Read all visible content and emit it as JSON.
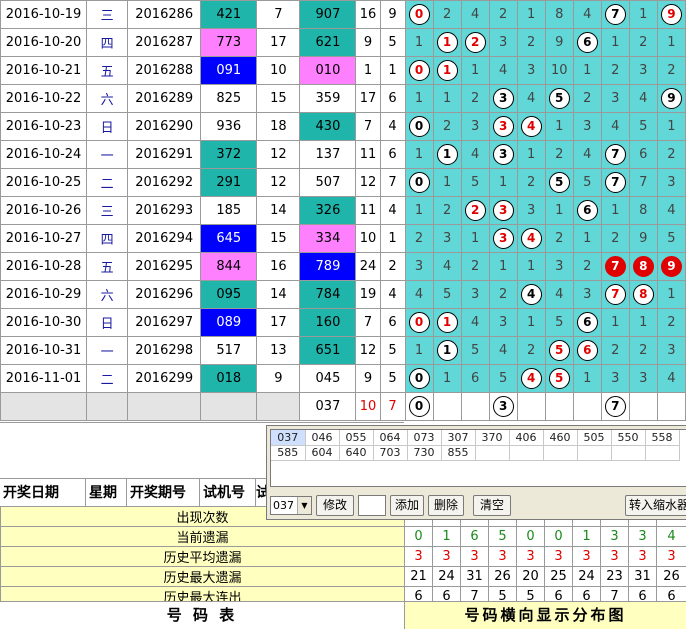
{
  "rows": [
    {
      "date": "2016-10-19",
      "week": "三",
      "period": "2016286",
      "trial": "421",
      "trial_bg": "tl",
      "sum": "7",
      "draw": "907",
      "draw_bg": "tl",
      "s2": "16",
      "s3": "9",
      "cells": [
        [
          "0",
          "r"
        ],
        [
          "2"
        ],
        [
          "4"
        ],
        [
          "2"
        ],
        [
          "1"
        ],
        [
          "8"
        ],
        [
          "4"
        ],
        [
          "7",
          "k"
        ],
        [
          "1"
        ],
        [
          "9",
          "r"
        ]
      ]
    },
    {
      "date": "2016-10-20",
      "week": "四",
      "period": "2016287",
      "trial": "773",
      "trial_bg": "pk",
      "sum": "17",
      "draw": "621",
      "draw_bg": "tl",
      "s2": "9",
      "s3": "5",
      "cells": [
        [
          "1"
        ],
        [
          "1",
          "r"
        ],
        [
          "2",
          "r"
        ],
        [
          "3"
        ],
        [
          "2"
        ],
        [
          "9"
        ],
        [
          "6",
          "k"
        ],
        [
          "1"
        ],
        [
          "2"
        ],
        [
          "1"
        ]
      ]
    },
    {
      "date": "2016-10-21",
      "week": "五",
      "period": "2016288",
      "trial": "091",
      "trial_bg": "bl",
      "sum": "10",
      "draw": "010",
      "draw_bg": "pk",
      "s2": "1",
      "s3": "1",
      "cells": [
        [
          "0",
          "r"
        ],
        [
          "1",
          "r"
        ],
        [
          "1"
        ],
        [
          "4"
        ],
        [
          "3"
        ],
        [
          "10"
        ],
        [
          "1"
        ],
        [
          "2"
        ],
        [
          "3"
        ],
        [
          "2"
        ]
      ]
    },
    {
      "date": "2016-10-22",
      "week": "六",
      "period": "2016289",
      "trial": "825",
      "trial_bg": "wh",
      "sum": "15",
      "draw": "359",
      "draw_bg": "wh",
      "s2": "17",
      "s3": "6",
      "cells": [
        [
          "1"
        ],
        [
          "1"
        ],
        [
          "2"
        ],
        [
          "3",
          "k"
        ],
        [
          "4"
        ],
        [
          "5",
          "k"
        ],
        [
          "2"
        ],
        [
          "3"
        ],
        [
          "4"
        ],
        [
          "9",
          "k"
        ]
      ]
    },
    {
      "date": "2016-10-23",
      "week": "日",
      "period": "2016290",
      "trial": "936",
      "trial_bg": "wh",
      "sum": "18",
      "draw": "430",
      "draw_bg": "tl",
      "s2": "7",
      "s3": "4",
      "cells": [
        [
          "0",
          "k"
        ],
        [
          "2"
        ],
        [
          "3"
        ],
        [
          "3",
          "r"
        ],
        [
          "4",
          "r"
        ],
        [
          "1"
        ],
        [
          "3"
        ],
        [
          "4"
        ],
        [
          "5"
        ],
        [
          "1"
        ]
      ]
    },
    {
      "date": "2016-10-24",
      "week": "一",
      "period": "2016291",
      "trial": "372",
      "trial_bg": "tl",
      "sum": "12",
      "draw": "137",
      "draw_bg": "wh",
      "s2": "11",
      "s3": "6",
      "cells": [
        [
          "1"
        ],
        [
          "1",
          "k"
        ],
        [
          "4"
        ],
        [
          "3",
          "k"
        ],
        [
          "1"
        ],
        [
          "2"
        ],
        [
          "4"
        ],
        [
          "7",
          "k"
        ],
        [
          "6"
        ],
        [
          "2"
        ]
      ]
    },
    {
      "date": "2016-10-25",
      "week": "二",
      "period": "2016292",
      "trial": "291",
      "trial_bg": "tl",
      "sum": "12",
      "draw": "507",
      "draw_bg": "wh",
      "s2": "12",
      "s3": "7",
      "cells": [
        [
          "0",
          "k"
        ],
        [
          "1"
        ],
        [
          "5"
        ],
        [
          "1"
        ],
        [
          "2"
        ],
        [
          "5",
          "k"
        ],
        [
          "5"
        ],
        [
          "7",
          "k"
        ],
        [
          "7"
        ],
        [
          "3"
        ]
      ]
    },
    {
      "date": "2016-10-26",
      "week": "三",
      "period": "2016293",
      "trial": "185",
      "trial_bg": "wh",
      "sum": "14",
      "draw": "326",
      "draw_bg": "tl",
      "s2": "11",
      "s3": "4",
      "cells": [
        [
          "1"
        ],
        [
          "2"
        ],
        [
          "2",
          "r"
        ],
        [
          "3",
          "r"
        ],
        [
          "3"
        ],
        [
          "1"
        ],
        [
          "6",
          "k"
        ],
        [
          "1"
        ],
        [
          "8"
        ],
        [
          "4"
        ]
      ]
    },
    {
      "date": "2016-10-27",
      "week": "四",
      "period": "2016294",
      "trial": "645",
      "trial_bg": "bl",
      "sum": "15",
      "draw": "334",
      "draw_bg": "pk",
      "s2": "10",
      "s3": "1",
      "cells": [
        [
          "2"
        ],
        [
          "3"
        ],
        [
          "1"
        ],
        [
          "3",
          "r"
        ],
        [
          "4",
          "r"
        ],
        [
          "2"
        ],
        [
          "1"
        ],
        [
          "2"
        ],
        [
          "9"
        ],
        [
          "5"
        ]
      ]
    },
    {
      "date": "2016-10-28",
      "week": "五",
      "period": "2016295",
      "trial": "844",
      "trial_bg": "pk",
      "sum": "16",
      "draw": "789",
      "draw_bg": "bl",
      "s2": "24",
      "s3": "2",
      "cells": [
        [
          "3"
        ],
        [
          "4"
        ],
        [
          "2"
        ],
        [
          "1"
        ],
        [
          "1"
        ],
        [
          "3"
        ],
        [
          "2"
        ],
        [
          "7",
          "f"
        ],
        [
          "8",
          "f"
        ],
        [
          "9",
          "f"
        ]
      ]
    },
    {
      "date": "2016-10-29",
      "week": "六",
      "period": "2016296",
      "trial": "095",
      "trial_bg": "tl",
      "sum": "14",
      "draw": "784",
      "draw_bg": "tl",
      "s2": "19",
      "s3": "4",
      "cells": [
        [
          "4"
        ],
        [
          "5"
        ],
        [
          "3"
        ],
        [
          "2"
        ],
        [
          "4",
          "k"
        ],
        [
          "4"
        ],
        [
          "3"
        ],
        [
          "7",
          "r"
        ],
        [
          "8",
          "r"
        ],
        [
          "1"
        ]
      ]
    },
    {
      "date": "2016-10-30",
      "week": "日",
      "period": "2016297",
      "trial": "089",
      "trial_bg": "bl",
      "sum": "17",
      "draw": "160",
      "draw_bg": "tl",
      "s2": "7",
      "s3": "6",
      "cells": [
        [
          "0",
          "r"
        ],
        [
          "1",
          "r"
        ],
        [
          "4"
        ],
        [
          "3"
        ],
        [
          "1"
        ],
        [
          "5"
        ],
        [
          "6",
          "k"
        ],
        [
          "1"
        ],
        [
          "1"
        ],
        [
          "2"
        ]
      ]
    },
    {
      "date": "2016-10-31",
      "week": "一",
      "period": "2016298",
      "trial": "517",
      "trial_bg": "wh",
      "sum": "13",
      "draw": "651",
      "draw_bg": "tl",
      "s2": "12",
      "s3": "5",
      "cells": [
        [
          "1"
        ],
        [
          "1",
          "k"
        ],
        [
          "5"
        ],
        [
          "4"
        ],
        [
          "2"
        ],
        [
          "5",
          "r"
        ],
        [
          "6",
          "r"
        ],
        [
          "2"
        ],
        [
          "2"
        ],
        [
          "3"
        ]
      ]
    },
    {
      "date": "2016-11-01",
      "week": "二",
      "period": "2016299",
      "trial": "018",
      "trial_bg": "tl",
      "sum": "9",
      "draw": "045",
      "draw_bg": "wh",
      "s2": "9",
      "s3": "5",
      "cells": [
        [
          "0",
          "k"
        ],
        [
          "1"
        ],
        [
          "6"
        ],
        [
          "5"
        ],
        [
          "4",
          "r"
        ],
        [
          "5",
          "r"
        ],
        [
          "1"
        ],
        [
          "3"
        ],
        [
          "3"
        ],
        [
          "4"
        ]
      ]
    }
  ],
  "pending": {
    "draw": "037",
    "s2": "10",
    "s3": "7",
    "cells": [
      [
        "0",
        "k"
      ],
      [
        ""
      ],
      [
        ""
      ],
      [
        "3",
        "k"
      ],
      [
        ""
      ],
      [
        ""
      ],
      [
        ""
      ],
      [
        "7",
        "k"
      ],
      [
        ""
      ],
      [
        ""
      ]
    ]
  },
  "headers": {
    "date": "开奖日期",
    "week": "星期",
    "period": "开奖期号",
    "trial": "试机号",
    "sum": "试"
  },
  "stats": [
    {
      "label": "出现次数",
      "values": [
        "",
        "",
        "",
        "",
        "",
        "",
        "",
        "",
        "",
        ""
      ]
    },
    {
      "label": "当前遗漏",
      "values": [
        "0",
        "1",
        "6",
        "5",
        "0",
        "0",
        "1",
        "3",
        "3",
        "4"
      ],
      "tone": "gr"
    },
    {
      "label": "历史平均遗漏",
      "values": [
        "3",
        "3",
        "3",
        "3",
        "3",
        "3",
        "3",
        "3",
        "3",
        "3"
      ],
      "tone": "rd"
    },
    {
      "label": "历史最大遗漏",
      "values": [
        "21",
        "24",
        "31",
        "26",
        "20",
        "25",
        "24",
        "23",
        "31",
        "26"
      ]
    },
    {
      "label": "历史最大连出",
      "values": [
        "6",
        "6",
        "7",
        "5",
        "5",
        "6",
        "6",
        "7",
        "6",
        "6"
      ]
    }
  ],
  "footer": {
    "left": "号 码 表",
    "right": "号码横向显示分布图"
  },
  "panel": {
    "values_row1": [
      "037",
      "046",
      "055",
      "064",
      "073",
      "307",
      "370",
      "406",
      "460",
      "505",
      "550",
      "558"
    ],
    "values_row2": [
      "585",
      "604",
      "640",
      "703",
      "730",
      "855"
    ],
    "select_value": "037",
    "buttons": {
      "modify": "修改",
      "add": "添加",
      "delete": "删除",
      "clear": "清空",
      "transfer": "转入缩水器"
    }
  },
  "colors": {
    "teal": "#1fb5aa",
    "pink": "#ff80ff",
    "blue": "#0000ff",
    "cyan": "#61d7d7",
    "red": "#e00000"
  }
}
